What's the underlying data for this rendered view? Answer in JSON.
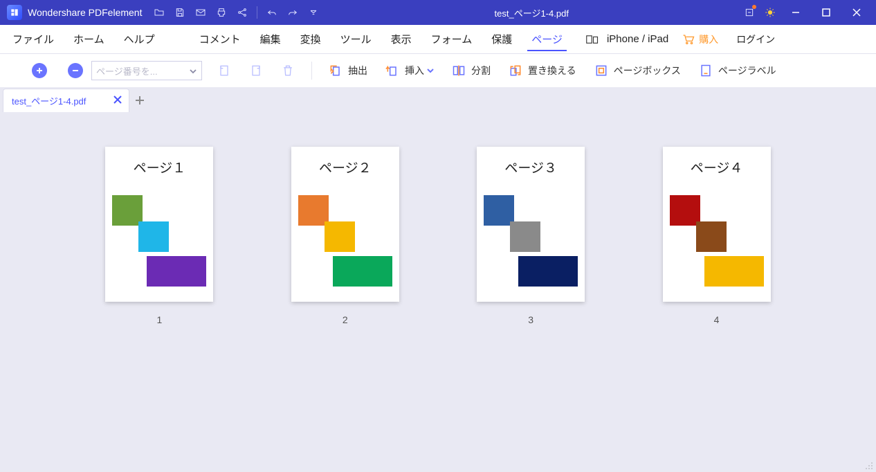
{
  "titlebar": {
    "appname": "Wondershare PDFelement",
    "docname": "test_ページ1-4.pdf"
  },
  "menubar": {
    "items_left": [
      "ファイル",
      "ホーム",
      "ヘルプ"
    ],
    "items_main": [
      "コメント",
      "編集",
      "変換",
      "ツール",
      "表示",
      "フォーム",
      "保護",
      "ページ"
    ],
    "active_index": 7,
    "device_label": "iPhone / iPad",
    "purchase_label": "購入",
    "login_label": "ログイン"
  },
  "toolbar": {
    "page_input_placeholder": "ページ番号を...",
    "extract_label": "抽出",
    "insert_label": "挿入",
    "split_label": "分割",
    "replace_label": "置き換える",
    "pagebox_label": "ページボックス",
    "pagelabel_label": "ページラベル"
  },
  "tabstrip": {
    "tab_label": "test_ページ1-4.pdf"
  },
  "pages": [
    {
      "title": "ページ１",
      "num": "1",
      "c1": "#6a9f3a",
      "c2": "#1fb6e8",
      "c3": "#6b2bb4"
    },
    {
      "title": "ページ２",
      "num": "2",
      "c1": "#e87a2e",
      "c2": "#f5b800",
      "c3": "#0aa85a"
    },
    {
      "title": "ページ３",
      "num": "3",
      "c1": "#2f5fa3",
      "c2": "#8a8a8a",
      "c3": "#0a1f63"
    },
    {
      "title": "ページ４",
      "num": "4",
      "c1": "#b40e0e",
      "c2": "#8a4a1a",
      "c3": "#f5b800"
    }
  ]
}
